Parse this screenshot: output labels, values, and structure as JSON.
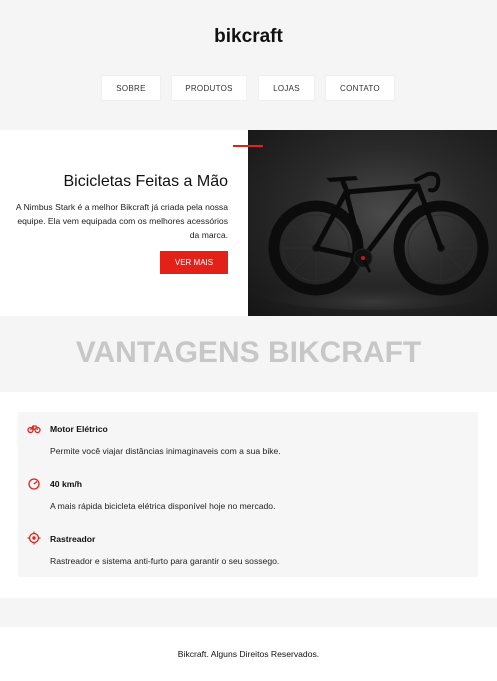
{
  "header": {
    "logo": "bikcraft",
    "nav": [
      {
        "label": "Sobre"
      },
      {
        "label": "Produtos"
      },
      {
        "label": "Lojas"
      },
      {
        "label": "Contato"
      }
    ]
  },
  "hero": {
    "title": "Bicicletas Feitas a Mão",
    "description": "A Nimbus Stark é a melhor Bikcraft já criada pela nossa equipe. Ela vem equipada com os melhores acessórios da marca.",
    "button_label": "Ver Mais",
    "image": "bicycle-photo"
  },
  "advantages": {
    "title": "VANTAGENS BIKCRAFT",
    "items": [
      {
        "icon": "motor-icon",
        "title": "Motor Elétrico",
        "description": "Permite você viajar distâncias inimaginaveis com a sua bike."
      },
      {
        "icon": "speedometer-icon",
        "title": "40 km/h",
        "description": "A mais rápida bicicleta elétrica disponível hoje no mercado."
      },
      {
        "icon": "target-icon",
        "title": "Rastreador",
        "description": "Rastreador e sistema anti-furto para garantir o seu sossego."
      }
    ]
  },
  "footer": {
    "text": "Bikcraft. Alguns Direitos Reservados."
  },
  "colors": {
    "accent": "#e42119",
    "background": "#f5f5f5",
    "heading_muted": "#c7c7c7"
  }
}
